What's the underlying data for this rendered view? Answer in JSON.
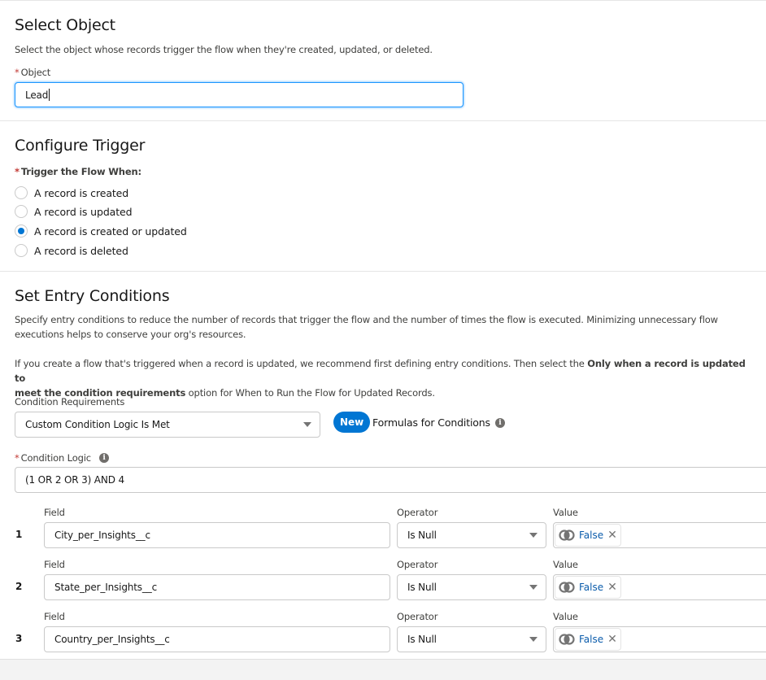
{
  "select_object": {
    "title": "Select Object",
    "description": "Select the object whose records trigger the flow when they're created, updated, or deleted.",
    "object_label": "Object",
    "object_value": "Lead"
  },
  "configure_trigger": {
    "title": "Configure Trigger",
    "trigger_label": "Trigger the Flow When:",
    "options": [
      {
        "label": "A record is created",
        "checked": false
      },
      {
        "label": "A record is updated",
        "checked": false
      },
      {
        "label": "A record is created or updated",
        "checked": true
      },
      {
        "label": "A record is deleted",
        "checked": false
      }
    ]
  },
  "entry_conditions": {
    "title": "Set Entry Conditions",
    "desc1_line1": "Specify entry conditions to reduce the number of records that trigger the flow and the number of times the flow is executed. Minimizing unnecessary flow",
    "desc1_line2": "executions helps to conserve your org's resources.",
    "desc2_line1_a": "If you create a flow that's triggered when a record is updated, we recommend first defining entry conditions. Then select the ",
    "desc2_line1_bold": "Only when a record is updated to",
    "desc2_line2_bold": "meet the condition requirements",
    "desc2_line2_b": " option for When to Run the Flow for Updated Records.",
    "condition_requirements_label": "Condition Requirements",
    "condition_requirements_value": "Custom Condition Logic Is Met",
    "new_badge": "New",
    "formulas_label": "Formulas for Conditions",
    "condition_logic_label": "Condition Logic",
    "condition_logic_value": "(1 OR 2 OR 3) AND 4",
    "field_header": "Field",
    "operator_header": "Operator",
    "value_header": "Value",
    "rows": [
      {
        "num": "1",
        "field": "City_per_Insights__c",
        "operator": "Is Null",
        "value": "False"
      },
      {
        "num": "2",
        "field": "State_per_Insights__c",
        "operator": "Is Null",
        "value": "False"
      },
      {
        "num": "3",
        "field": "Country_per_Insights__c",
        "operator": "Is Null",
        "value": "False"
      }
    ]
  },
  "colors": {
    "brand": "#0176d3",
    "required": "#c23934",
    "link": "#0b5cab"
  }
}
